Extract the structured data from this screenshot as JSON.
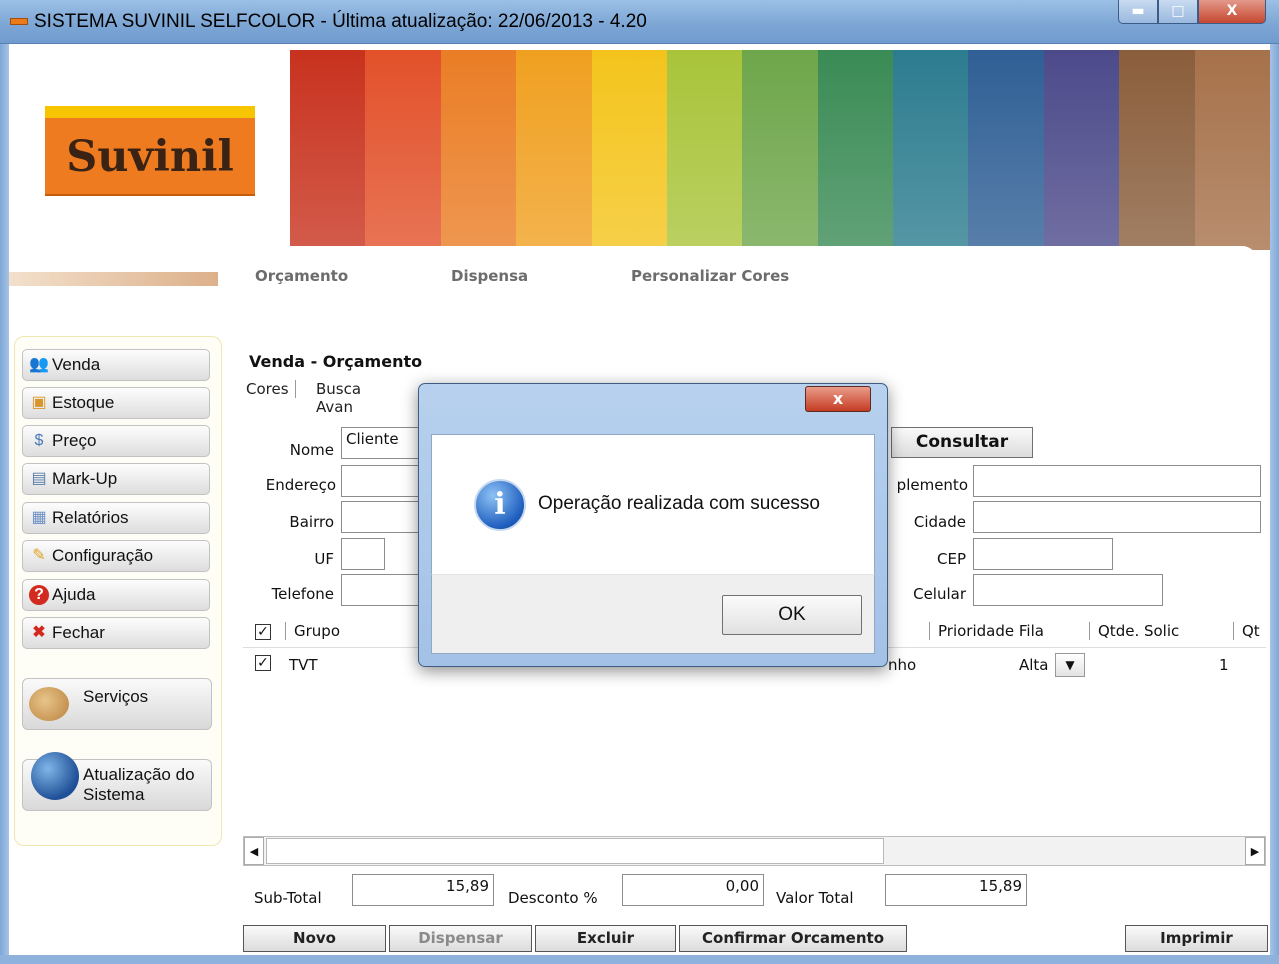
{
  "window": {
    "title": "SISTEMA SUVINIL SELFCOLOR - Última atualização: 22/06/2013 - 4.20",
    "min_glyph": "▬",
    "max_glyph": "□",
    "close_glyph": "X"
  },
  "logo": {
    "text": "Suvinil"
  },
  "banner": {
    "colors": [
      "#c8321e",
      "#e2512a",
      "#ea7d25",
      "#f0a020",
      "#f4c41c",
      "#a9c43a",
      "#6ea64a",
      "#3a8b55",
      "#2c7c8f",
      "#2f5f95",
      "#4c4a8a",
      "#8a5e3c",
      "#a6714a"
    ]
  },
  "top_tabs": [
    "Orçamento",
    "Dispensa",
    "Personalizar Cores"
  ],
  "sidebar": {
    "items": [
      {
        "label": "Venda",
        "icon": "users-icon"
      },
      {
        "label": "Estoque",
        "icon": "box-icon"
      },
      {
        "label": "Preço",
        "icon": "price-icon"
      },
      {
        "label": "Mark-Up",
        "icon": "markup-icon"
      },
      {
        "label": "Relatórios",
        "icon": "reports-icon"
      },
      {
        "label": "Configuração",
        "icon": "wrench-icon"
      },
      {
        "label": "Ajuda",
        "icon": "help-icon"
      },
      {
        "label": "Fechar",
        "icon": "close-icon"
      }
    ],
    "servicos": "Serviços",
    "atualizacao_line1": "Atualização do",
    "atualizacao_line2": "Sistema"
  },
  "section_title": "Venda - Orçamento",
  "sub_tabs": [
    "Cores",
    "Busca Avan"
  ],
  "form": {
    "nome_label": "Nome",
    "nome_value": "Cliente",
    "endereco_label": "Endereço",
    "bairro_label": "Bairro",
    "uf_label": "UF",
    "telefone_label": "Telefone",
    "complemento_label": "plemento",
    "cidade_label": "Cidade",
    "cep_label": "CEP",
    "celular_label": "Celular",
    "consultar": "Consultar"
  },
  "grid": {
    "headers": [
      "Grupo",
      "Prioridade Fila",
      "Qtde. Solic",
      "Qt"
    ],
    "rows": [
      {
        "grupo": "TVT",
        "col4": "nho",
        "prioridade": "Alta",
        "qtde": "1"
      }
    ]
  },
  "totals": {
    "subtotal_label": "Sub-Total",
    "subtotal_value": "15,89",
    "desconto_label": "Desconto %",
    "desconto_value": "0,00",
    "valor_total_label": "Valor Total",
    "valor_total_value": "15,89"
  },
  "bottom_buttons": {
    "novo": "Novo",
    "dispensar": "Dispensar",
    "excluir": "Excluir",
    "confirmar": "Confirmar Orcamento",
    "imprimir": "Imprimir"
  },
  "dialog": {
    "close": "x",
    "message": "Operação realizada com sucesso",
    "ok": "OK",
    "icon": "info-icon"
  }
}
